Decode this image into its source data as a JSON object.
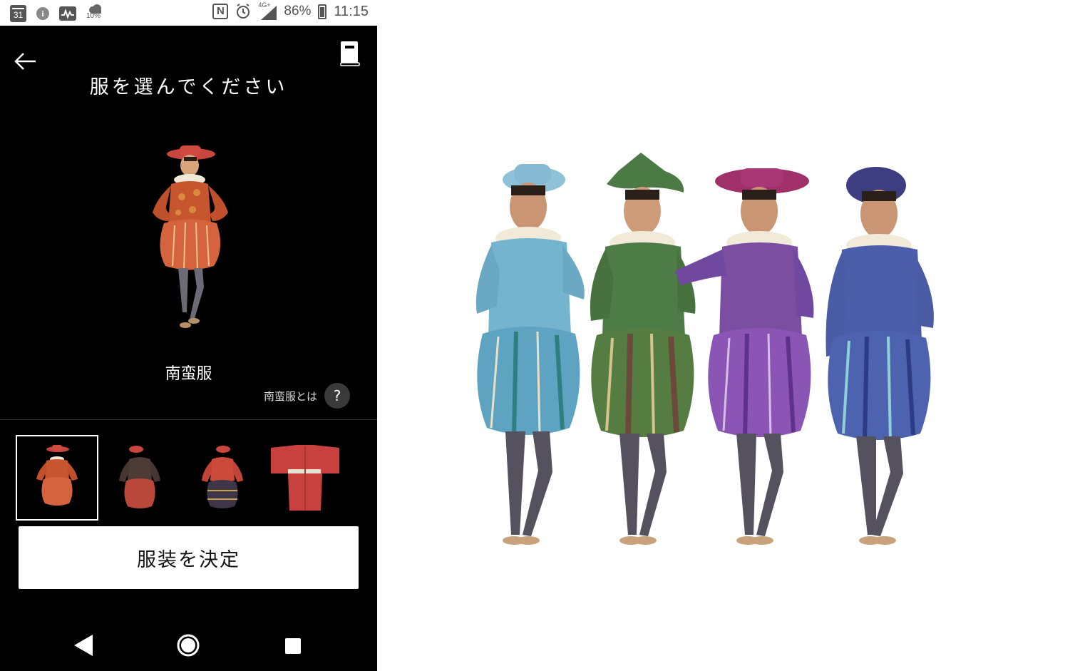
{
  "status_bar": {
    "calendar_day": "31",
    "weather_percent": "10%",
    "network": "4G+",
    "battery": "86%",
    "time": "11:15",
    "icons": [
      "calendar-icon",
      "info-icon",
      "activity-icon",
      "weather-icon",
      "nfc-icon",
      "alarm-icon",
      "signal-icon",
      "battery-icon"
    ]
  },
  "header": {
    "title": "服を選んでください",
    "back_icon": "back-arrow-icon",
    "book_icon": "book-icon"
  },
  "preview": {
    "costume_name": "南蛮服",
    "help_text": "南蛮服とは",
    "help_button": "?"
  },
  "costume_thumbnails": [
    {
      "name": "costume-red-doublet",
      "selected": true
    },
    {
      "name": "costume-dark-doublet",
      "selected": false
    },
    {
      "name": "costume-red-jacket-striped",
      "selected": false
    },
    {
      "name": "costume-red-kimono",
      "selected": false
    },
    {
      "name": "costume-partial",
      "selected": false
    }
  ],
  "decide_button": {
    "label": "服装を決定"
  },
  "nav_bar": {
    "buttons": [
      "nav-back",
      "nav-home",
      "nav-recent"
    ]
  },
  "illustration": {
    "figures": [
      {
        "name": "figure-blue",
        "color": "#7fb6cf"
      },
      {
        "name": "figure-green",
        "color": "#4f7d45"
      },
      {
        "name": "figure-purple",
        "color": "#7a4f9e"
      },
      {
        "name": "figure-navy",
        "color": "#4b5ea8"
      }
    ]
  }
}
